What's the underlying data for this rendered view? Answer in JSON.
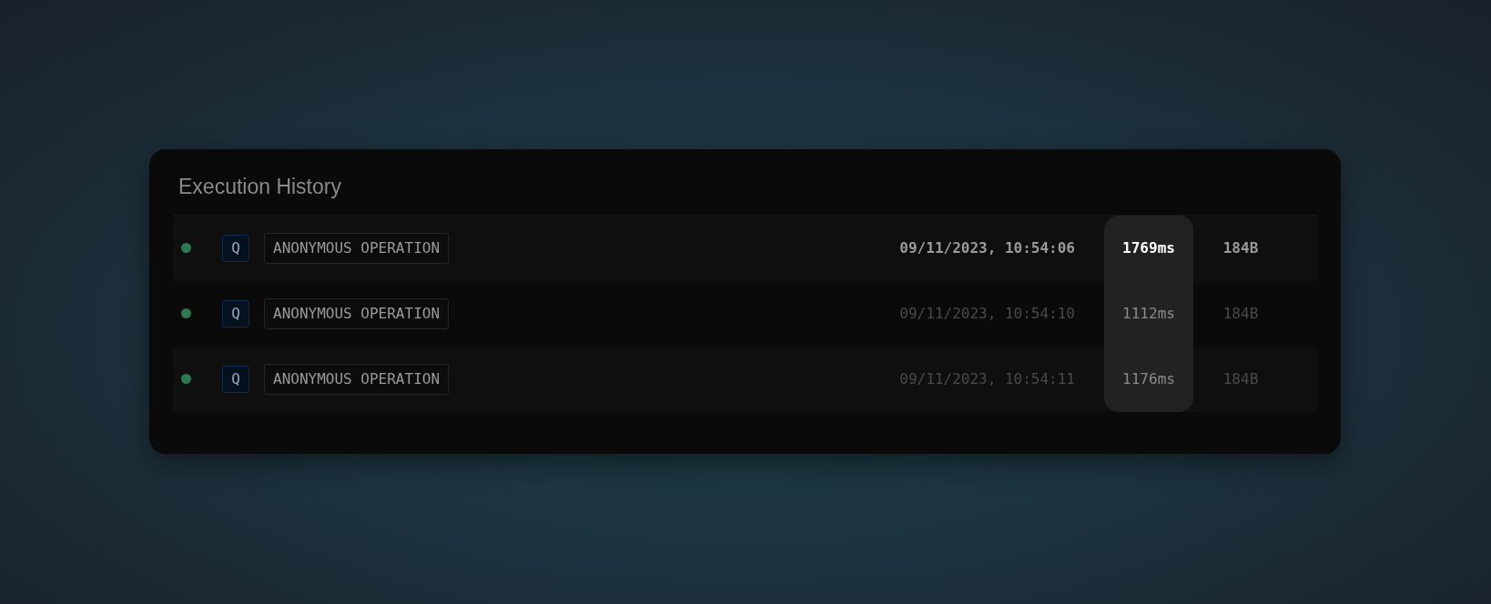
{
  "panel": {
    "title": "Execution History"
  },
  "rows": [
    {
      "ok": true,
      "type": "Q",
      "operation": "ANONYMOUS OPERATION",
      "time": "09/11/2023, 10:54:06",
      "duration": "1769ms",
      "size": "184B",
      "selected": true
    },
    {
      "ok": true,
      "type": "Q",
      "operation": "ANONYMOUS OPERATION",
      "time": "09/11/2023, 10:54:10",
      "duration": "1112ms",
      "size": "184B",
      "selected": false
    },
    {
      "ok": true,
      "type": "Q",
      "operation": "ANONYMOUS OPERATION",
      "time": "09/11/2023, 10:54:11",
      "duration": "1176ms",
      "size": "184B",
      "selected": false
    }
  ]
}
